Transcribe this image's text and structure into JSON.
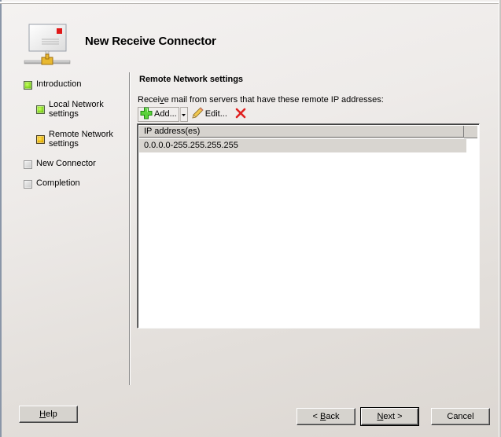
{
  "header": {
    "title": "New Receive Connector",
    "icon": "mail-connector-icon"
  },
  "nav": {
    "items": [
      {
        "label": "Introduction",
        "status": "complete",
        "status_color": "#7ed21a",
        "indent": 0
      },
      {
        "label": "Local Network settings",
        "status": "complete",
        "status_color": "#7ed21a",
        "indent": 1
      },
      {
        "label": "Remote Network settings",
        "status": "current",
        "status_color": "#e6b000",
        "indent": 1
      },
      {
        "label": "New Connector",
        "status": "pending",
        "status_color": "#c8c8c8",
        "indent": 0
      },
      {
        "label": "Completion",
        "status": "pending",
        "status_color": "#c8c8c8",
        "indent": 0
      }
    ]
  },
  "main": {
    "section_title": "Remote Network settings",
    "description_pre": "Recei",
    "description_accel": "v",
    "description_post": "e mail from servers that have these remote IP addresses:",
    "toolbar": {
      "add_label": "Add...",
      "edit_label": "Edit...",
      "add_icon": "green-plus-icon",
      "dropdown_icon": "chevron-down-icon",
      "edit_icon": "pencil-icon",
      "remove_icon": "red-x-icon"
    },
    "list": {
      "columns": [
        "IP address(es)"
      ],
      "rows": [
        "0.0.0.0-255.255.255.255"
      ]
    }
  },
  "footer": {
    "help_accel": "H",
    "help_rest": "elp",
    "back_pre": "< ",
    "back_accel": "B",
    "back_rest": "ack",
    "next_accel": "N",
    "next_rest": "ext >",
    "cancel_label": "Cancel"
  }
}
